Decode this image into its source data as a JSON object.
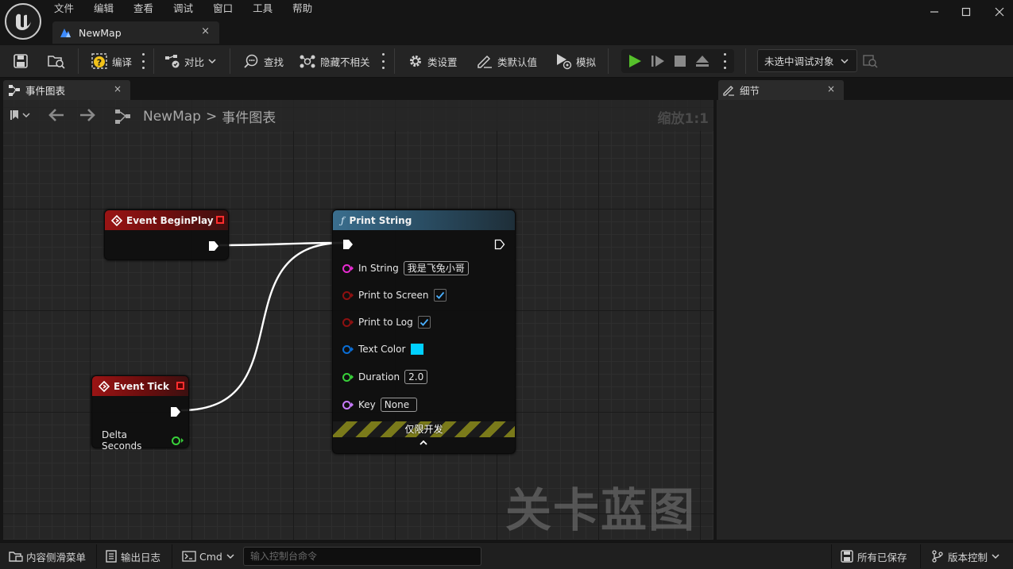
{
  "menu": [
    "文件",
    "编辑",
    "查看",
    "调试",
    "窗口",
    "工具",
    "帮助"
  ],
  "document_tab": {
    "label": "NewMap",
    "close": "×"
  },
  "toolbar": {
    "compile": "编译",
    "diff": "对比",
    "find": "查找",
    "hide_unrelated": "隐藏不相关",
    "class_settings": "类设置",
    "class_defaults": "类默认值",
    "simulate": "模拟",
    "debug_target": "未选中调试对象"
  },
  "left_panel": {
    "tab_label": "事件图表",
    "close": "×",
    "breadcrumb_root": "NewMap",
    "breadcrumb_sep": ">",
    "breadcrumb_current": "事件图表",
    "zoom": "缩放1:1",
    "watermark": "关卡蓝图"
  },
  "right_panel": {
    "tab_label": "细节",
    "close": "×"
  },
  "nodes": {
    "begin_play": {
      "title": "Event BeginPlay"
    },
    "tick": {
      "title": "Event Tick",
      "output": "Delta Seconds"
    },
    "print_string": {
      "title": "Print String",
      "in_string_label": "In String",
      "in_string_value": "我是飞兔小哥",
      "print_to_screen_label": "Print to Screen",
      "print_to_screen": true,
      "print_to_log_label": "Print to Log",
      "print_to_log": true,
      "text_color_label": "Text Color",
      "text_color": "#00d0ff",
      "duration_label": "Duration",
      "duration_value": "2.0",
      "key_label": "Key",
      "key_value": "None",
      "dev_only": "仅限开发"
    }
  },
  "statusbar": {
    "content_drawer": "内容侧滑菜单",
    "output_log": "输出日志",
    "cmd": "Cmd",
    "cmd_placeholder": "输入控制台命令",
    "all_saved": "所有已保存",
    "source_control": "版本控制"
  },
  "colors": {
    "event_header": "#9a1414",
    "function_header": "#3a6e8e",
    "string_pin": "#e62bd0",
    "bool_pin": "#8e1010",
    "struct_pin": "#0a6ed6",
    "float_pin": "#38d13a",
    "name_pin": "#c87bff",
    "play_green": "#56c02b"
  }
}
